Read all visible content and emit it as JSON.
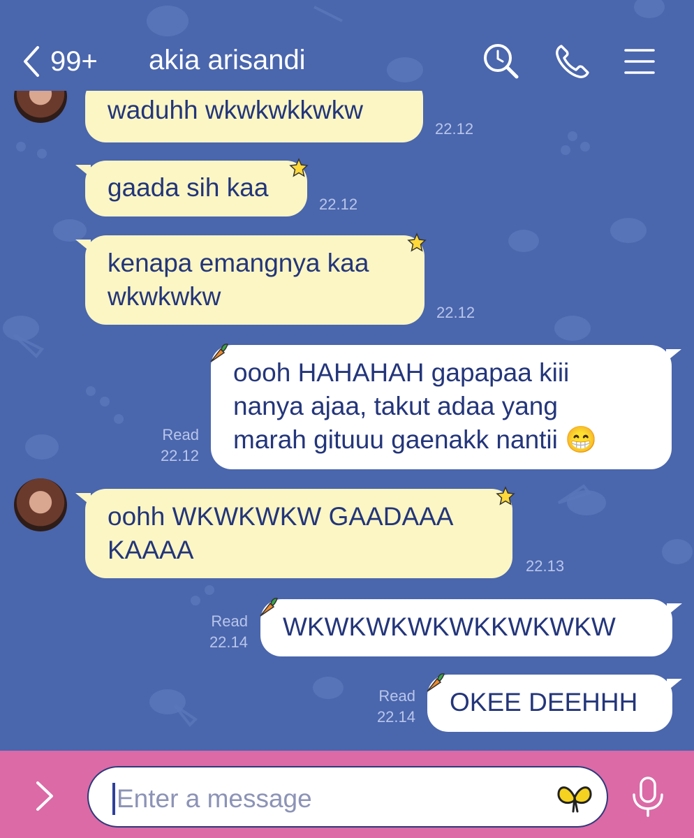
{
  "header": {
    "unread_count": "99+",
    "title": "akia arisandi"
  },
  "messages": [
    {
      "dir": "in",
      "text": "waduhh wkwkwkkwkw",
      "time": "22.12"
    },
    {
      "dir": "in",
      "text": "gaada sih kaa",
      "time": "22.12"
    },
    {
      "dir": "in",
      "lines": [
        "kenapa emangnya kaa",
        "wkwkwkw"
      ],
      "time": "22.12"
    },
    {
      "dir": "out",
      "lines": [
        "oooh HAHAHAH gapapaa kiii",
        "nanya ajaa, takut adaa yang",
        "marah gituuu gaenakk nantii 😁"
      ],
      "read": "Read",
      "time": "22.12"
    },
    {
      "dir": "in",
      "lines": [
        "oohh WKWKWKW GAADAAA",
        "KAAAA"
      ],
      "time": "22.13"
    },
    {
      "dir": "out",
      "text": "WKWKWKWKWKKWKWKW",
      "read": "Read",
      "time": "22.14"
    },
    {
      "dir": "out",
      "text": "OKEE DEEHHH",
      "read": "Read",
      "time": "22.14"
    }
  ],
  "input": {
    "placeholder": "Enter a message"
  },
  "colors": {
    "background": "#4a66ad",
    "incoming_bubble": "#fbf6c4",
    "outgoing_bubble": "#ffffff",
    "input_bar": "#db6aa6",
    "bubble_text": "#23357a"
  }
}
